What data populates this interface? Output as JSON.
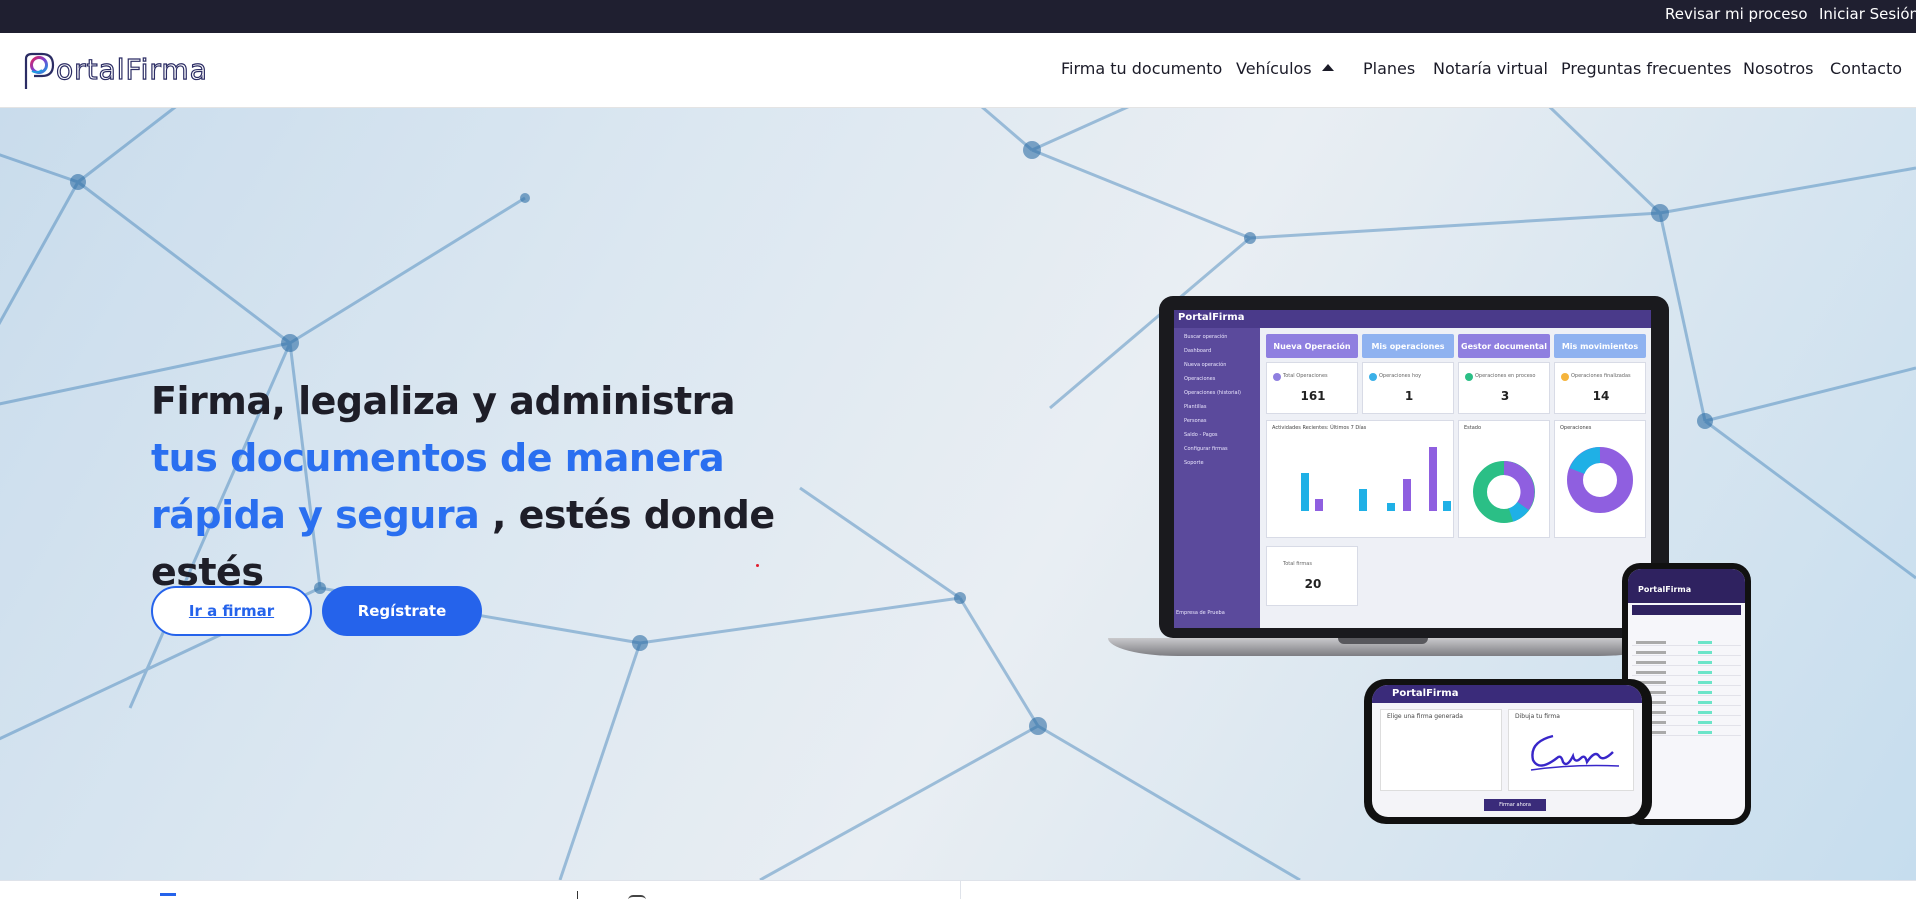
{
  "topbar": {
    "links": [
      "Revisar mi proceso",
      "Iniciar Sesión"
    ]
  },
  "header": {
    "logo_text": "ortalFirma",
    "logo_mark": "P",
    "nav": [
      "Firma tu documento",
      "Vehículos",
      "Planes",
      "Notaría virtual",
      "Preguntas frecuentes",
      "Nosotros",
      "Contacto"
    ]
  },
  "hero": {
    "headline_dark_1": "Firma, legaliza y administra",
    "headline_blue": "tus documentos de manera rápida y segura",
    "headline_dark_2": ", estés donde estés",
    "btn_primary_outline": "Ir a firmar",
    "btn_primary_fill": "Regístrate"
  },
  "mockup": {
    "app_logo": "PortalFirma",
    "sidebar": [
      "Buscar operación",
      "Dashboard",
      "Nueva operación",
      "Operaciones",
      "Operaciones (historial)",
      "Plantillas",
      "Personas",
      "Saldo - Pagos",
      "Configurar firmas",
      "Soporte"
    ],
    "company": "Empresa de Prueba",
    "tabs": [
      "Nueva Operación",
      "Mis operaciones",
      "Gestor documental",
      "Mis movimientos"
    ],
    "stats": [
      {
        "label": "Total Operaciones",
        "value": "161",
        "color": "#8f7fe0"
      },
      {
        "label": "Operaciones hoy",
        "value": "1",
        "color": "#3ab0e8"
      },
      {
        "label": "Operaciones en proceso",
        "value": "3",
        "color": "#2bbf86"
      },
      {
        "label": "Operaciones finalizadas",
        "value": "14",
        "color": "#f5b43c"
      }
    ],
    "panel_activity": "Actividades Recientes: Últimos 7 Días",
    "panel_estado": "Estado",
    "panel_operaciones": "Operaciones",
    "firmas_label": "Total firmas",
    "firmas_value": "20",
    "phone_logo": "PortalFirma",
    "phone_card1": "Elige una firma generada",
    "phone_card2": "Dibuja tu firma",
    "phone_button": "Firmar ahora"
  },
  "colors": {
    "accent": "#2563eb",
    "topbar": "#1f1f30",
    "app_purple": "#5b4a9c"
  }
}
